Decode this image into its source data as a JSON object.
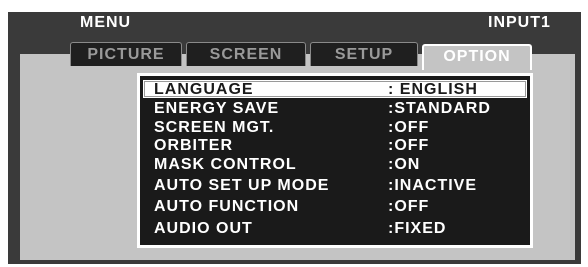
{
  "header": {
    "menu_title": "MENU",
    "input_label": "INPUT1"
  },
  "tabs": [
    {
      "label": "PICTURE",
      "active": false
    },
    {
      "label": "SCREEN",
      "active": false
    },
    {
      "label": "SETUP",
      "active": false
    },
    {
      "label": "OPTION",
      "active": true
    }
  ],
  "options": [
    {
      "label": "LANGUAGE",
      "value": ": ENGLISH",
      "selected": true
    },
    {
      "label": "ENERGY SAVE",
      "value": ":STANDARD",
      "selected": false
    },
    {
      "label": "SCREEN MGT.",
      "value": ":OFF",
      "selected": false
    },
    {
      "label": "ORBITER",
      "value": ":OFF",
      "selected": false
    },
    {
      "label": "MASK CONTROL",
      "value": ":ON",
      "selected": false
    },
    {
      "label": "AUTO SET UP MODE",
      "value": ":INACTIVE",
      "selected": false
    },
    {
      "label": "AUTO FUNCTION",
      "value": ":OFF",
      "selected": false
    },
    {
      "label": "AUDIO OUT",
      "value": ":FIXED",
      "selected": false
    }
  ],
  "colors": {
    "frame": "#3a3a3a",
    "body": "#c4c4c4",
    "panel": "#1a1a1a",
    "highlight": "#ffffff",
    "text": "#ffffff"
  }
}
